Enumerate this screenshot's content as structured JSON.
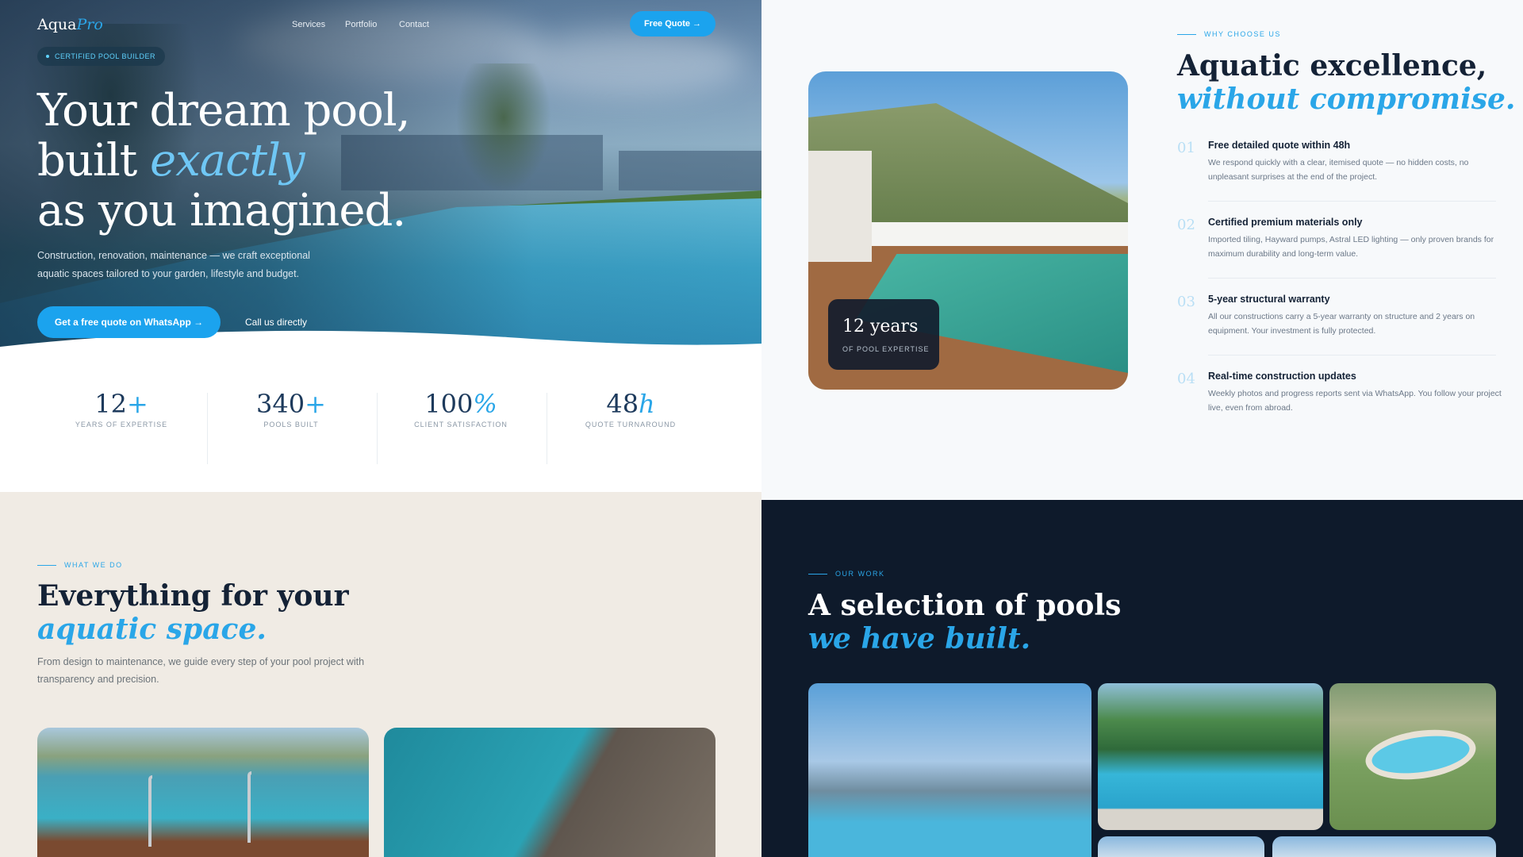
{
  "nav": {
    "logo_main": "Aqua",
    "logo_accent": "Pro",
    "links": [
      "Services",
      "Portfolio",
      "Contact"
    ],
    "cta": "Free Quote →"
  },
  "hero": {
    "badge": "CERTIFIED POOL BUILDER",
    "title_line1": "Your dream pool,",
    "title_line2_plain": "built ",
    "title_line2_accent": "exactly",
    "title_line3": "as you imagined.",
    "subtitle": "Construction, renovation, maintenance — we craft exceptional aquatic spaces tailored to your garden, lifestyle and budget.",
    "primary_button": "Get a free quote on WhatsApp →",
    "secondary_link": "Call us directly"
  },
  "stats": [
    {
      "value": "12",
      "suffix": "+",
      "label": "YEARS OF EXPERTISE"
    },
    {
      "value": "340",
      "suffix": "+",
      "label": "POOLS BUILT"
    },
    {
      "value": "100",
      "suffix": "%",
      "label": "CLIENT SATISFACTION"
    },
    {
      "value": "48",
      "suffix": "h",
      "label": "QUOTE TURNAROUND"
    }
  ],
  "why": {
    "kicker": "WHY CHOOSE US",
    "title_line1": "Aquatic excellence,",
    "title_line2": "without compromise.",
    "card_big": "12 years",
    "card_small": "OF POOL EXPERTISE",
    "features": [
      {
        "num": "01",
        "title": "Free detailed quote within 48h",
        "desc": "We respond quickly with a clear, itemised quote — no hidden costs, no unpleasant surprises at the end of the project."
      },
      {
        "num": "02",
        "title": "Certified premium materials only",
        "desc": "Imported tiling, Hayward pumps, Astral LED lighting — only proven brands for maximum durability and long-term value."
      },
      {
        "num": "03",
        "title": "5-year structural warranty",
        "desc": "All our constructions carry a 5-year warranty on structure and 2 years on equipment. Your investment is fully protected."
      },
      {
        "num": "04",
        "title": "Real-time construction updates",
        "desc": "Weekly photos and progress reports sent via WhatsApp. You follow your project live, even from abroad."
      }
    ]
  },
  "what": {
    "kicker": "WHAT WE DO",
    "title_line1": "Everything for your",
    "title_line2": "aquatic space.",
    "subtitle": "From design to maintenance, we guide every step of your pool project with transparency and precision."
  },
  "work": {
    "kicker": "OUR WORK",
    "title_line1": "A selection of pools",
    "title_line2": "we have built."
  },
  "colors": {
    "accent": "#2aa6e8",
    "button": "#1ba3ee",
    "dark_navy": "#0e1a2b",
    "beige": "#f0ebe4"
  }
}
